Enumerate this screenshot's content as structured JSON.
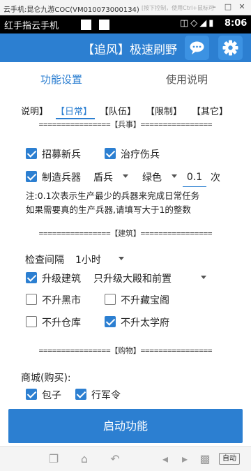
{
  "host": {
    "title": "云手机:昆仑九游COC(VM010073000134)",
    "hint": "[按下控制，使用Ctrl+鼠标可",
    "buttons": [
      "minimize-icon",
      "maximize-icon",
      "close-icon"
    ]
  },
  "statusbar": {
    "left": "红手指云手机",
    "time": "8:06",
    "icons": [
      "vibrate-icon",
      "wifi-icon",
      "signal-icon",
      "battery-icon"
    ]
  },
  "appbar": {
    "title": "【追风】极速刷野",
    "buttons": [
      "chat-icon",
      "gear-icon"
    ]
  },
  "tabs": {
    "items": [
      "功能设置",
      "使用说明"
    ],
    "active": 0
  },
  "subtabs": {
    "items": [
      "说明】",
      "【日常】",
      "【队伍】",
      "【限制】",
      "【其它】"
    ],
    "active": 1
  },
  "sections": {
    "military": "================【兵事】================",
    "building": "================【建筑】================",
    "shopping": "================【购物】================"
  },
  "military": {
    "recruit": {
      "label": "招募新兵",
      "checked": true
    },
    "heal": {
      "label": "治疗伤兵",
      "checked": true
    },
    "make": {
      "label": "制造兵器",
      "checked": true
    },
    "soldier_select": "盾兵",
    "color_select": "绿色",
    "times_value": "0.1",
    "times_unit": "次",
    "note_line1": "注:0.1次表示生产最少的兵器来完成日常任务",
    "note_line2": "如果需要真的生产兵器,请填写大于1的整数"
  },
  "building": {
    "interval_label": "检查间隔",
    "interval_select": "1小时",
    "upgrade": {
      "label": "升级建筑",
      "checked": true
    },
    "upgrade_select": "只升级大殿和前置",
    "no_market": {
      "label": "不升黑市",
      "checked": false
    },
    "no_treasure": {
      "label": "不升藏宝阁",
      "checked": false
    },
    "no_warehouse": {
      "label": "不升仓库",
      "checked": false
    },
    "no_academy": {
      "label": "不升太学府",
      "checked": true
    }
  },
  "shopping": {
    "mall_label": "商城(购买):",
    "bun": {
      "label": "包子",
      "checked": true
    },
    "march_order": {
      "label": "行军令",
      "checked": true
    }
  },
  "start_button": "启动功能",
  "navbar": {
    "auto_label": "自动",
    "icons": [
      "recent-apps-icon",
      "home-icon",
      "back-icon",
      "volume-down-icon",
      "volume-up-icon",
      "screen-icon"
    ]
  }
}
